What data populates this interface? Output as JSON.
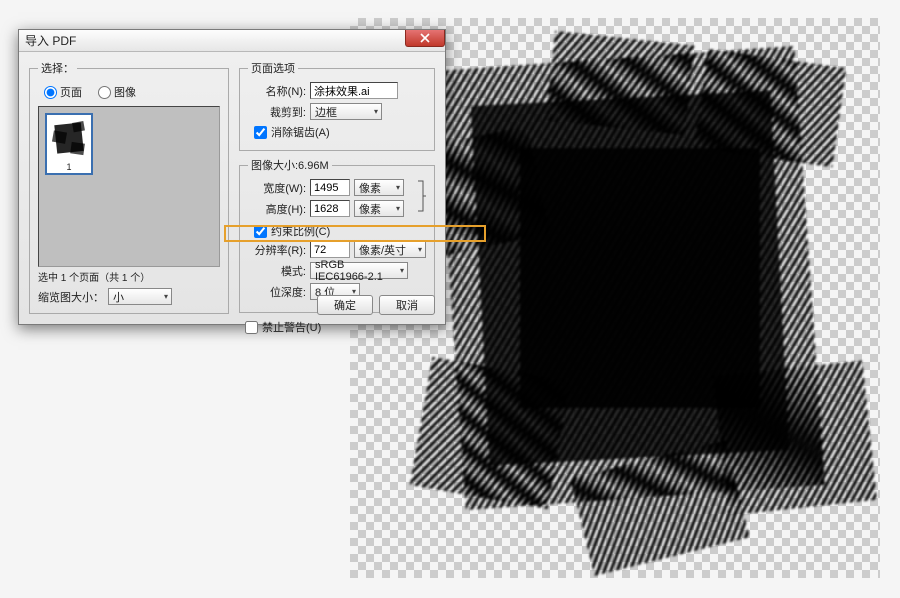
{
  "dialog": {
    "title": "导入 PDF",
    "selectGroup": {
      "legend": "选择：",
      "radio_page": "页面",
      "radio_image": "图像",
      "selected_radio": "page",
      "thumbnail_caption": "1",
      "selected_note": "选中 1 个页面（共 1 个）",
      "thumbsize_label": "缩览图大小：",
      "thumbsize_value": "小"
    },
    "pageOptions": {
      "legend": "页面选项",
      "name_label": "名称(N):",
      "name_value": "涂抹效果.ai",
      "crop_label": "裁剪到:",
      "crop_value": "边框",
      "antialias_label": "消除锯齿(A)",
      "antialias_checked": true
    },
    "imageSize": {
      "legend": "图像大小:6.96M",
      "width_label": "宽度(W):",
      "width_value": "1495",
      "width_unit": "像素",
      "height_label": "高度(H):",
      "height_value": "1628",
      "height_unit": "像素",
      "constrain_label": "约束比例(C)",
      "constrain_checked": true,
      "res_label": "分辨率(R):",
      "res_value": "72",
      "res_unit": "像素/英寸",
      "mode_label": "模式:",
      "mode_value": "sRGB IEC61966-2.1",
      "bitdepth_label": "位深度:",
      "bitdepth_value": "8 位"
    },
    "suppress_warn": {
      "label": "禁止警告(U)",
      "checked": false
    },
    "buttons": {
      "ok": "确定",
      "cancel": "取消"
    }
  }
}
